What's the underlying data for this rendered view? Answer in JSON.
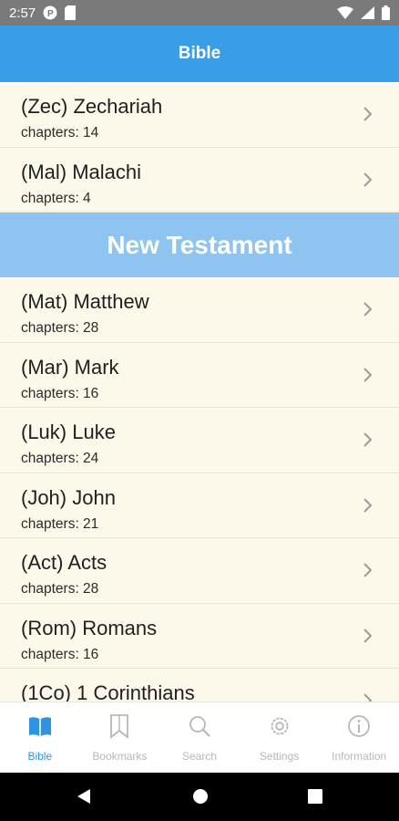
{
  "status_bar": {
    "time": "2:57"
  },
  "header": {
    "title": "Bible"
  },
  "books_before": [
    {
      "title": "(Zec) Zechariah",
      "chapters": "chapters: 14"
    },
    {
      "title": "(Mal) Malachi",
      "chapters": "chapters: 4"
    }
  ],
  "section": {
    "title": "New Testament"
  },
  "books_after": [
    {
      "title": "(Mat) Matthew",
      "chapters": "chapters: 28"
    },
    {
      "title": "(Mar) Mark",
      "chapters": "chapters: 16"
    },
    {
      "title": "(Luk) Luke",
      "chapters": "chapters: 24"
    },
    {
      "title": "(Joh) John",
      "chapters": "chapters: 21"
    },
    {
      "title": "(Act) Acts",
      "chapters": "chapters: 28"
    },
    {
      "title": "(Rom) Romans",
      "chapters": "chapters: 16"
    },
    {
      "title": "(1Co) 1 Corinthians",
      "chapters": ""
    }
  ],
  "tabs": [
    {
      "label": "Bible",
      "icon": "book-open-icon",
      "active": true
    },
    {
      "label": "Bookmarks",
      "icon": "bookmark-icon",
      "active": false
    },
    {
      "label": "Search",
      "icon": "search-icon",
      "active": false
    },
    {
      "label": "Settings",
      "icon": "gear-icon",
      "active": false
    },
    {
      "label": "Information",
      "icon": "info-icon",
      "active": false
    }
  ],
  "colors": {
    "header": "#3a9ee6",
    "section": "#8ec4ef",
    "active_tab": "#2e93e0",
    "inactive_tab": "#b7b7b7",
    "list_bg": "#fdf9ea"
  }
}
